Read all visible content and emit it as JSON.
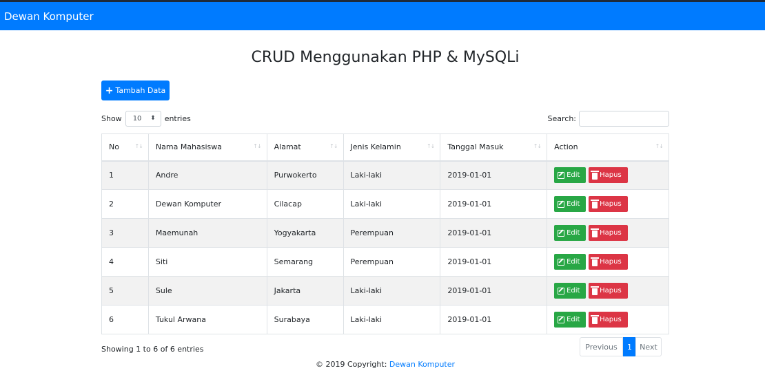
{
  "navbar": {
    "brand": "Dewan Komputer"
  },
  "page": {
    "title": "CRUD Menggunakan PHP & MySQLi"
  },
  "toolbar": {
    "add_label": "Tambah Data"
  },
  "length": {
    "show_label": "Show",
    "value": "10",
    "entries_label": "entries"
  },
  "search": {
    "label": "Search:",
    "value": ""
  },
  "table": {
    "headers": [
      "No",
      "Nama Mahasiswa",
      "Alamat",
      "Jenis Kelamin",
      "Tanggal Masuk",
      "Action"
    ],
    "rows": [
      {
        "no": "1",
        "nama": "Andre",
        "alamat": "Purwokerto",
        "jk": "Laki-laki",
        "tgl": "2019-01-01"
      },
      {
        "no": "2",
        "nama": "Dewan Komputer",
        "alamat": "Cilacap",
        "jk": "Laki-laki",
        "tgl": "2019-01-01"
      },
      {
        "no": "3",
        "nama": "Maemunah",
        "alamat": "Yogyakarta",
        "jk": "Perempuan",
        "tgl": "2019-01-01"
      },
      {
        "no": "4",
        "nama": "Siti",
        "alamat": "Semarang",
        "jk": "Perempuan",
        "tgl": "2019-01-01"
      },
      {
        "no": "5",
        "nama": "Sule",
        "alamat": "Jakarta",
        "jk": "Laki-laki",
        "tgl": "2019-01-01"
      },
      {
        "no": "6",
        "nama": "Tukul Arwana",
        "alamat": "Surabaya",
        "jk": "Laki-laki",
        "tgl": "2019-01-01"
      }
    ],
    "edit_label": "Edit",
    "delete_label": "Hapus"
  },
  "info": {
    "text": "Showing 1 to 6 of 6 entries"
  },
  "pagination": {
    "previous": "Previous",
    "current": "1",
    "next": "Next"
  },
  "footer": {
    "copyright": "© 2019 Copyright:",
    "link": "Dewan Komputer"
  },
  "colors": {
    "primary": "#007bff",
    "success": "#28a745",
    "danger": "#dc3545",
    "stripe": "#f2f2f2"
  }
}
